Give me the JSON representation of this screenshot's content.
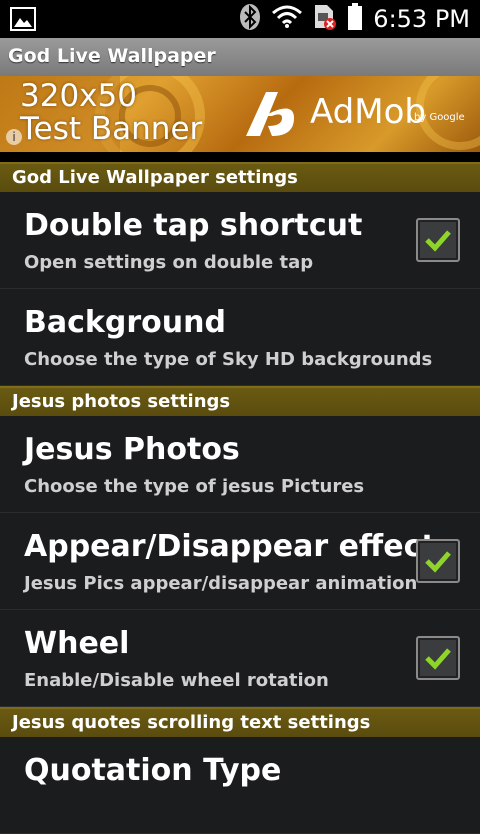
{
  "status_bar": {
    "time": "6:53 PM",
    "icons": [
      "image-icon",
      "bluetooth-icon",
      "wifi-icon",
      "sim-icon",
      "battery-icon"
    ]
  },
  "app": {
    "title": "God Live Wallpaper"
  },
  "ad": {
    "line1": "320x50",
    "line2": "Test Banner",
    "brand": "AdMob",
    "by": "by Google"
  },
  "sections": [
    {
      "header": "God Live Wallpaper settings",
      "items": [
        {
          "title": "Double tap shortcut",
          "summary": "Open settings on double tap",
          "checked": true
        },
        {
          "title": "Background",
          "summary": "Choose the type of Sky HD backgrounds",
          "checked": null
        }
      ]
    },
    {
      "header": "Jesus photos settings",
      "items": [
        {
          "title": "Jesus Photos",
          "summary": "Choose the type of jesus Pictures",
          "checked": null
        },
        {
          "title": "Appear/Disappear effect",
          "summary": "Jesus Pics appear/disappear animation",
          "checked": true
        },
        {
          "title": "Wheel",
          "summary": "Enable/Disable wheel rotation",
          "checked": true
        }
      ]
    },
    {
      "header": "Jesus quotes scrolling text settings",
      "items": [
        {
          "title": "Quotation Type",
          "summary": "",
          "checked": null
        }
      ]
    }
  ],
  "colors": {
    "section_header": "#5a4c0e",
    "checkmark": "#8fd42a",
    "background": "#1a1c1e"
  }
}
